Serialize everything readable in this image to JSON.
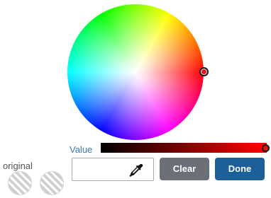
{
  "picker": {
    "value_label": "Value",
    "original_label": "original",
    "selected_color": "#e21414",
    "hex_value": "",
    "eyedropper_icon": "eyedropper-icon"
  },
  "buttons": {
    "clear_label": "Clear",
    "done_label": "Done"
  },
  "colors": {
    "clear_bg": "#6a6f78",
    "done_bg": "#1d5f98",
    "label_blue": "#3a78b0"
  }
}
